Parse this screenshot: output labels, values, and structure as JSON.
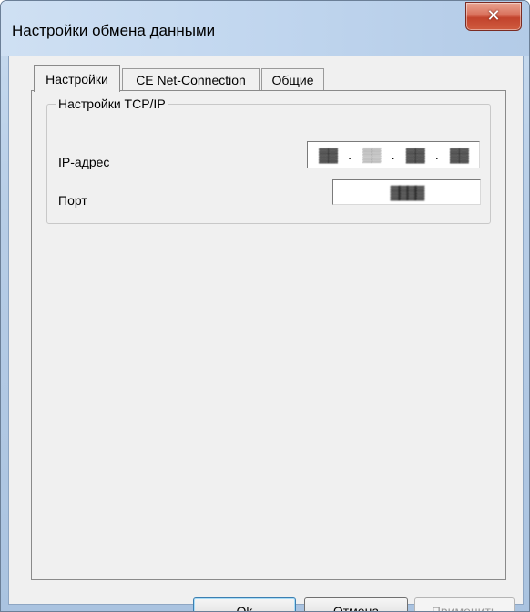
{
  "window": {
    "title": "Настройки обмена данными",
    "close_symbol": "✕"
  },
  "tabs": [
    {
      "label": "Настройки",
      "active": true
    },
    {
      "label": "CE Net-Connection",
      "active": false
    },
    {
      "label": "Общие",
      "active": false
    }
  ],
  "tcpip_group": {
    "title": "Настройки TCP/IP",
    "ip_label": "IP-адрес",
    "ip_octets": [
      "▓▓",
      "▒▒",
      "▓▓",
      "▓▓"
    ],
    "ip_separator": ".",
    "port_label": "Порт",
    "port_value": "▓▓▓▓"
  },
  "buttons": {
    "ok": "Ok",
    "cancel": "Отмена",
    "apply": "Применить"
  },
  "colors": {
    "window_frame": "#b7cde6",
    "close_button": "#c2432c",
    "dialog_bg": "#f0f0f0",
    "disabled_text": "#9a9a9a"
  }
}
